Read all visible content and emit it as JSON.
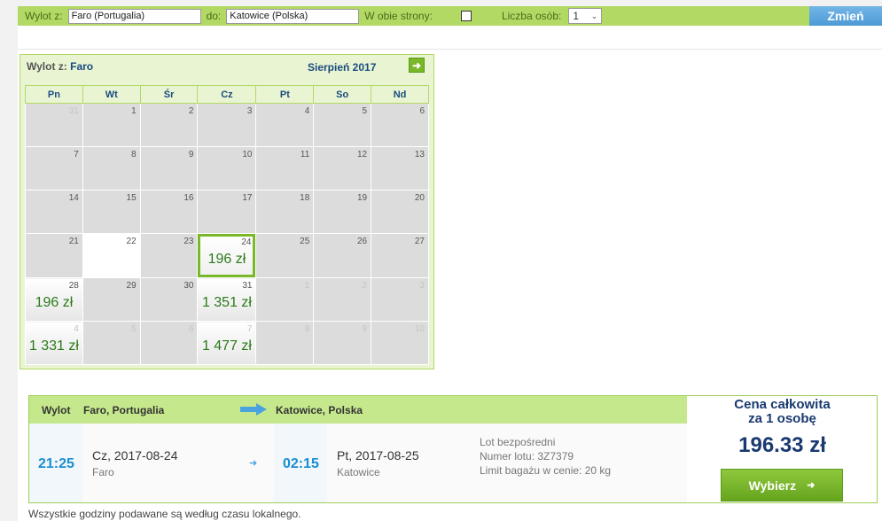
{
  "search": {
    "from_label": "Wylot z:",
    "from_value": "Faro (Portugalia)",
    "to_label": "do:",
    "to_value": "Katowice (Polska)",
    "roundtrip_label": "W obie strony:",
    "roundtrip_checked": false,
    "persons_label": "Liczba osób:",
    "persons_value": "1",
    "change_button": "Zmień"
  },
  "calendar": {
    "from_label": "Wylot z:",
    "from_city": "Faro",
    "month": "Sierpień 2017",
    "weekdays": [
      "Pn",
      "Wt",
      "Śr",
      "Cz",
      "Pt",
      "So",
      "Nd"
    ],
    "weeks": [
      [
        {
          "d": "31",
          "other": true
        },
        {
          "d": "1"
        },
        {
          "d": "2"
        },
        {
          "d": "3"
        },
        {
          "d": "4"
        },
        {
          "d": "5"
        },
        {
          "d": "6"
        }
      ],
      [
        {
          "d": "7"
        },
        {
          "d": "8"
        },
        {
          "d": "9"
        },
        {
          "d": "10"
        },
        {
          "d": "11"
        },
        {
          "d": "12"
        },
        {
          "d": "13"
        }
      ],
      [
        {
          "d": "14"
        },
        {
          "d": "15"
        },
        {
          "d": "16"
        },
        {
          "d": "17"
        },
        {
          "d": "18"
        },
        {
          "d": "19"
        },
        {
          "d": "20"
        }
      ],
      [
        {
          "d": "21"
        },
        {
          "d": "22",
          "today": true
        },
        {
          "d": "23"
        },
        {
          "d": "24",
          "price": "196 zł",
          "selected": true
        },
        {
          "d": "25"
        },
        {
          "d": "26"
        },
        {
          "d": "27"
        }
      ],
      [
        {
          "d": "28",
          "price": "196 zł"
        },
        {
          "d": "29"
        },
        {
          "d": "30"
        },
        {
          "d": "31",
          "price": "1 351 zł"
        },
        {
          "d": "1",
          "other": true
        },
        {
          "d": "2",
          "other": true
        },
        {
          "d": "3",
          "other": true
        }
      ],
      [
        {
          "d": "4",
          "other": true,
          "price": "1 331 zł"
        },
        {
          "d": "5",
          "other": true
        },
        {
          "d": "6",
          "other": true
        },
        {
          "d": "7",
          "other": true,
          "price": "1 477 zł"
        },
        {
          "d": "8",
          "other": true
        },
        {
          "d": "9",
          "other": true
        },
        {
          "d": "10",
          "other": true
        }
      ]
    ]
  },
  "flight": {
    "header_label": "Wylot",
    "origin": "Faro, Portugalia",
    "destination": "Katowice, Polska",
    "dep_time": "21:25",
    "dep_day": "Cz,",
    "dep_date": "2017-08-24",
    "dep_city": "Faro",
    "arr_time": "02:15",
    "arr_day": "Pt,",
    "arr_date": "2017-08-25",
    "arr_city": "Katowice",
    "info_direct": "Lot bezpośredni",
    "info_flight": "Numer lotu: 3Z7379",
    "info_baggage": "Limit bagażu w cenie: 20 kg",
    "price_title_1": "Cena całkowita",
    "price_title_2": "za 1 osobę",
    "price": "196.33 zł",
    "select_button": "Wybierz"
  },
  "footer_note": "Wszystkie godziny podawane są według czasu lokalnego.",
  "colors": {
    "accent_green": "#b3d965",
    "button_blue": "#4d9ad6",
    "time_blue": "#1a8ed1",
    "price_green": "#2a7a18"
  }
}
